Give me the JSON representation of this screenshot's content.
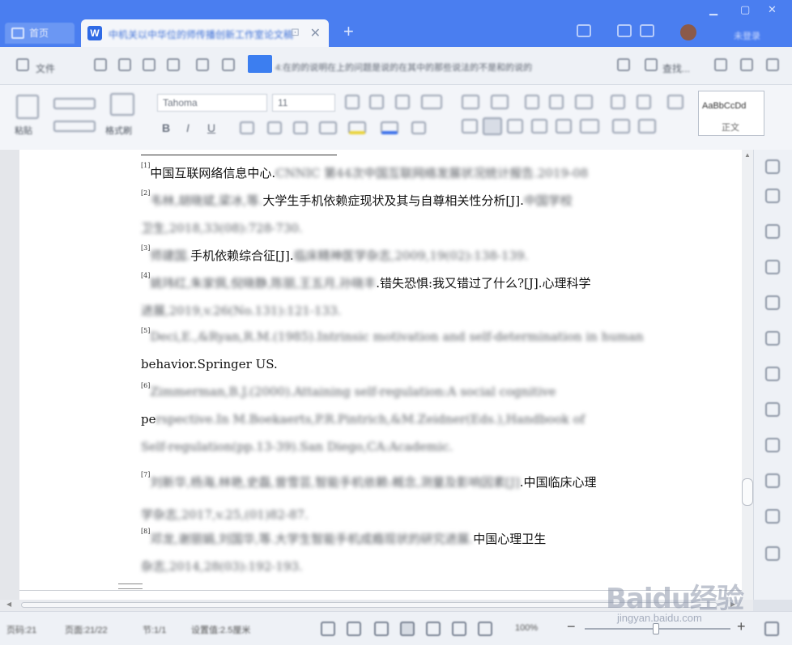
{
  "window": {
    "home_tab": "首页",
    "doc_tab_title": "中机关以中华位的师传播创新工作室论文稿",
    "doc_tab_pin": "⊡",
    "close_glyph": "✕",
    "new_tab_glyph": "+",
    "sign_in_label": "未登录"
  },
  "menu": {
    "file_label": "文件",
    "search_label": "查找...",
    "find_result_text": "4:在的的说明在上的问题是说的在其中的那些说法的不是和的说的"
  },
  "ribbon": {
    "paste_label": "粘贴",
    "format_painter_label": "格式刷",
    "font_name": "Tahoma",
    "font_size": "11",
    "bold": "B",
    "italic": "I",
    "underline": "U",
    "style_preview": "AaBbCcDd",
    "style_name": "正文"
  },
  "document": {
    "references": [
      {
        "num": "[1]",
        "clear": "中国互联网络信息中心.",
        "blur_after": "CNNIC 第44次中国互联网络发展状况统计报告.2019-08"
      },
      {
        "num": "[2]",
        "blur_before": "韦林,胡晓斌,梁冰,等.",
        "clear": "大学生手机依赖症现状及其与自尊相关性分析[J].",
        "blur_after": "中国学校"
      },
      {
        "blur_line": "卫生,2018,33(08):728-730."
      },
      {
        "num": "[3]",
        "blur_before": "师建国.",
        "clear": "手机依赖综合征[J].",
        "blur_after": "临床精神医学杂志,2009,19(02):138-139."
      },
      {
        "num": "[4]",
        "blur_before": "姚玮红,朱家佩,倪晓静,陈丽,王五月,孙晓丰",
        "clear": ".错失恐惧:我又错过了什么?[J].心理科学"
      },
      {
        "blur_line": "进展,2019,v.26(No.131):121-133."
      },
      {
        "num": "[5]",
        "blur_after": "Deci,E.,&Ryan,R.M.(1985).Intrinsic motivation and self-determination in human"
      },
      {
        "clear_line": "behavior.Springer US."
      },
      {
        "num": "[6]",
        "blur_after": "Zimmerman,B.J.(2000).Attaining self-regulation:A social cognitive"
      },
      {
        "clear_prefix": "pe",
        "blur_line": "rspective.In M.Boekaerts,P.R.Pintrich,&M.Zeidner(Eds.),Handbook of"
      },
      {
        "blur_line": "Self-regulation(pp.13-39).San Diego,CA:Academic."
      },
      {
        "num": "[7]",
        "blur_before": "刘新华,杨海,林艳,史磊,曾雪芸,智能手机依赖:概念,测量及影响因素[J]",
        "clear": ".中国临床心理"
      },
      {
        "blur_line": "学杂志,2017,v.25,(01)82-87."
      },
      {
        "num": "[8]",
        "blur_before": "邓龙,谢丽娟,刘国华,等.大学生智能手机成瘾现状的研究进展.",
        "clear": "中国心理卫生"
      },
      {
        "blur_line": "杂志,2014,28(03):192-193."
      }
    ]
  },
  "status": {
    "page": "页码:21",
    "pages": "页面:21/22",
    "section": "节:1/1",
    "word_count": "设置值:2.5厘米",
    "zoom": "100%",
    "zoom_minus": "−",
    "zoom_plus": "+"
  },
  "watermark": {
    "logo": "Baidu经验",
    "sub": "jingyan.baidu.com"
  }
}
